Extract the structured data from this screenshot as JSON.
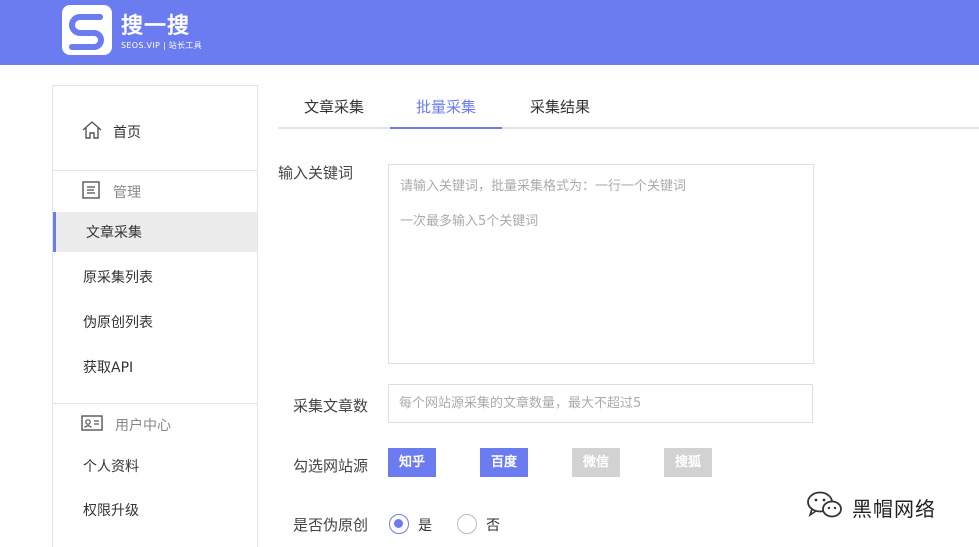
{
  "header": {
    "brand_title": "搜一搜",
    "brand_subtitle": "SEOS.VIP | 站长工具",
    "accent_color": "#6b7bf0"
  },
  "sidebar": {
    "home": {
      "label": "首页",
      "icon": "home-icon"
    },
    "manage_section": {
      "label": "管理",
      "icon": "document-icon"
    },
    "manage_items": [
      {
        "label": "文章采集",
        "active": true
      },
      {
        "label": "原采集列表",
        "active": false
      },
      {
        "label": "伪原创列表",
        "active": false
      },
      {
        "label": "获取API",
        "active": false
      }
    ],
    "user_section": {
      "label": "用户中心",
      "icon": "id-card-icon"
    },
    "user_items": [
      {
        "label": "个人资料"
      },
      {
        "label": "权限升级"
      }
    ]
  },
  "tabs": [
    {
      "label": "文章采集",
      "active": false
    },
    {
      "label": "批量采集",
      "active": true
    },
    {
      "label": "采集结果",
      "active": false
    }
  ],
  "form": {
    "keywords_label": "输入关键词",
    "keywords_placeholder_line1": "请输入关键词，批量采集格式为：一行一个关键词",
    "keywords_placeholder_line2": "一次最多输入5个关键词",
    "count_label": "采集文章数",
    "count_placeholder": "每个网站源采集的文章数量，最大不超过5",
    "sources_label": "勾选网站源",
    "sources": [
      {
        "label": "知乎",
        "selected": true
      },
      {
        "label": "百度",
        "selected": true
      },
      {
        "label": "微信",
        "selected": false
      },
      {
        "label": "搜狐",
        "selected": false
      }
    ],
    "pseudo_label": "是否伪原创",
    "pseudo_options": [
      {
        "label": "是",
        "checked": true
      },
      {
        "label": "否",
        "checked": false
      }
    ]
  },
  "watermark": {
    "text": "黑帽网络",
    "icon": "wechat-icon"
  }
}
